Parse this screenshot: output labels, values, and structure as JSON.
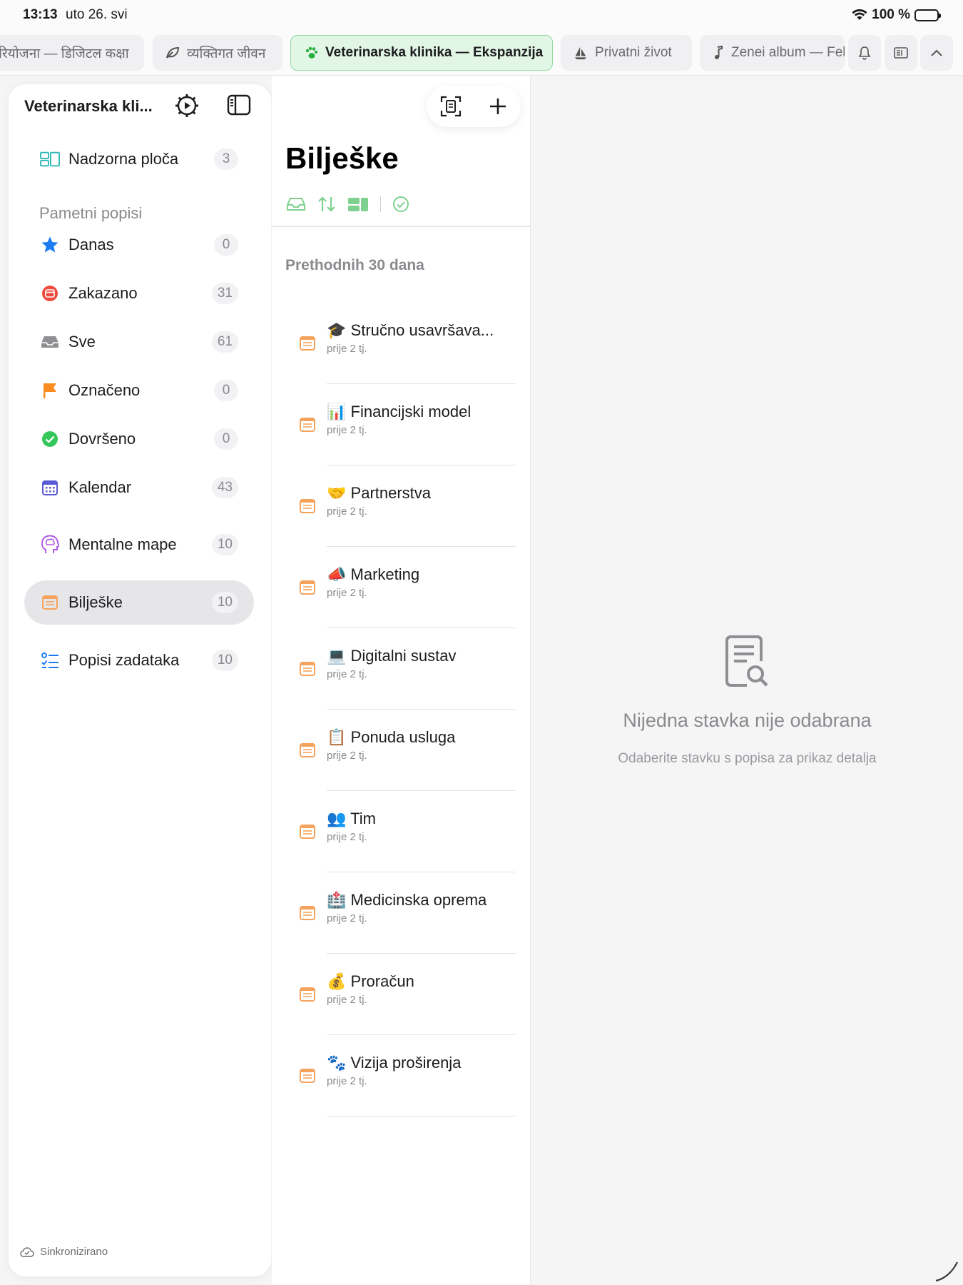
{
  "status": {
    "time": "13:13",
    "date": "uto 26. svi",
    "battery": "100 %"
  },
  "tabs": [
    {
      "label": "रियोजना — डिजिटल कक्षा",
      "icon": "none"
    },
    {
      "label": "व्यक्तिगत जीवन",
      "icon": "leaf-icon"
    },
    {
      "label": "Veterinarska klinika — Ekspanzija",
      "icon": "paw-icon",
      "active": true
    },
    {
      "label": "Privatni život",
      "icon": "sailboat-icon"
    },
    {
      "label": "Zenei album — Fel",
      "icon": "music-note-icon"
    }
  ],
  "sidebar": {
    "title": "Veterinarska kli...",
    "dashboard": {
      "label": "Nadzorna ploča",
      "count": "3"
    },
    "section_label": "Pametni popisi",
    "items": [
      {
        "label": "Danas",
        "count": "0"
      },
      {
        "label": "Zakazano",
        "count": "31"
      },
      {
        "label": "Sve",
        "count": "61"
      },
      {
        "label": "Označeno",
        "count": "0"
      },
      {
        "label": "Dovršeno",
        "count": "0"
      },
      {
        "label": "Kalendar",
        "count": "43"
      },
      {
        "label": "Mentalne mape",
        "count": "10"
      },
      {
        "label": "Bilješke",
        "count": "10"
      },
      {
        "label": "Popisi zadataka",
        "count": "10"
      }
    ],
    "sync_status": "Sinkronizirano"
  },
  "list": {
    "title": "Bilješke",
    "section": "Prethodnih 30 dana",
    "notes": [
      {
        "emoji": "🎓",
        "title": "Stručno usavršava...",
        "date": "prije 2 tj."
      },
      {
        "emoji": "📊",
        "title": "Financijski model",
        "date": "prije 2 tj."
      },
      {
        "emoji": "🤝",
        "title": "Partnerstva",
        "date": "prije 2 tj."
      },
      {
        "emoji": "📣",
        "title": "Marketing",
        "date": "prije 2 tj."
      },
      {
        "emoji": "💻",
        "title": "Digitalni sustav",
        "date": "prije 2 tj."
      },
      {
        "emoji": "📋",
        "title": "Ponuda usluga",
        "date": "prije 2 tj."
      },
      {
        "emoji": "👥",
        "title": "Tim",
        "date": "prije 2 tj."
      },
      {
        "emoji": "🏥",
        "title": "Medicinska oprema",
        "date": "prije 2 tj."
      },
      {
        "emoji": "💰",
        "title": "Proračun",
        "date": "prije 2 tj."
      },
      {
        "emoji": "🐾",
        "title": "Vizija proširenja",
        "date": "prije 2 tj."
      }
    ]
  },
  "detail": {
    "empty_title": "Nijedna stavka nije odabrana",
    "empty_subtitle": "Odaberite stavku s popisa za prikaz detalja"
  },
  "colors": {
    "accent_green": "#34c759",
    "note_orange": "#f5a35c",
    "star_blue": "#1e7cf2",
    "scheduled_red": "#f04a3e",
    "flag_orange": "#fb8c1f",
    "calendar_purple": "#5b5bd6",
    "mind_purple": "#b05be0"
  }
}
